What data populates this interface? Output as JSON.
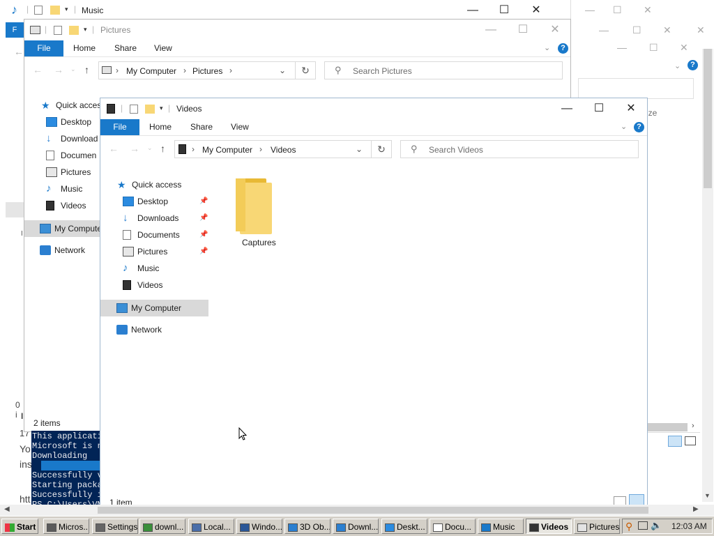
{
  "music_window": {
    "title": "Music",
    "minimize": "—",
    "maximize": "☐",
    "close": "✕"
  },
  "pictures_window": {
    "title": "Pictures",
    "tabs": [
      "File",
      "Home",
      "Share",
      "View"
    ],
    "breadcrumb": [
      "My Computer",
      "Pictures"
    ],
    "search_placeholder": "Search Pictures",
    "nav": {
      "quick_access": "Quick acces",
      "items": [
        "Desktop",
        "Download",
        "Documen",
        "Pictures",
        "Music",
        "Videos"
      ],
      "my_computer": "My Compute",
      "network": "Network"
    },
    "status": "2 items"
  },
  "videos_window": {
    "title": "Videos",
    "tabs": [
      "File",
      "Home",
      "Share",
      "View"
    ],
    "breadcrumb": [
      "My Computer",
      "Videos"
    ],
    "search_placeholder": "Search Videos",
    "nav": {
      "quick_access": "Quick access",
      "items": [
        {
          "label": "Desktop",
          "pinned": true,
          "icon": "desktop-icon"
        },
        {
          "label": "Downloads",
          "pinned": true,
          "icon": "downloads-icon"
        },
        {
          "label": "Documents",
          "pinned": true,
          "icon": "documents-icon"
        },
        {
          "label": "Pictures",
          "pinned": true,
          "icon": "pictures-icon"
        },
        {
          "label": "Music",
          "pinned": false,
          "icon": "music-icon"
        },
        {
          "label": "Videos",
          "pinned": false,
          "icon": "videos-icon"
        }
      ],
      "my_computer": "My Computer",
      "network": "Network"
    },
    "files": [
      {
        "name": "Captures",
        "icon": "folder-icon"
      }
    ],
    "status": "1 item"
  },
  "background_window": {
    "size_label": "ize"
  },
  "powershell": {
    "lines": [
      "This applicati",
      "Microsoft is n",
      "Downloading",
      "",
      "Successfully v",
      "Starting packa",
      "Successfully i",
      "PS C:\\Users\\VM"
    ]
  },
  "left_fragments": {
    "f": "F",
    "zero": "0 i",
    "one": "17",
    "you": "Yo",
    "ins": "ins",
    "htt": "htt"
  },
  "taskbar": {
    "start": "Start",
    "items": [
      {
        "label": "Micros...",
        "icon": "store-icon",
        "active": false
      },
      {
        "label": "Settings",
        "icon": "settings-icon",
        "active": false
      },
      {
        "label": "downl...",
        "icon": "chrome-icon",
        "active": false
      },
      {
        "label": "Local...",
        "icon": "window-icon",
        "active": false
      },
      {
        "label": "Windo...",
        "icon": "powershell-icon",
        "active": false
      },
      {
        "label": "3D Ob...",
        "icon": "3d-objects-icon",
        "active": false
      },
      {
        "label": "Downl...",
        "icon": "downloads-icon",
        "active": false
      },
      {
        "label": "Deskt...",
        "icon": "desktop-icon",
        "active": false
      },
      {
        "label": "Docu...",
        "icon": "documents-icon",
        "active": false
      },
      {
        "label": "Music",
        "icon": "music-icon",
        "active": false
      },
      {
        "label": "Videos",
        "icon": "videos-icon",
        "active": true
      },
      {
        "label": "Pictures",
        "icon": "pictures-icon",
        "active": false
      }
    ],
    "clock": "12:03 AM"
  },
  "colors": {
    "accent": "#1979ca",
    "taskbar": "#d4d0c8",
    "powershell_bg": "#012456",
    "folder": "#f8d775"
  }
}
